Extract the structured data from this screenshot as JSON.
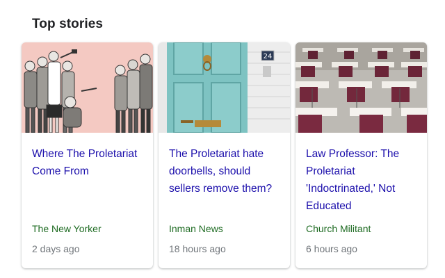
{
  "section": {
    "title": "Top stories"
  },
  "stories": [
    {
      "headline": "Where The Proletariat Come From",
      "source": "The New Yorker",
      "time": "2 days ago",
      "image": "cartoon-crowd-illustration"
    },
    {
      "headline": "The Proletariat hate doorbells, should sellers remove them?",
      "source": "Inman News",
      "time": "18 hours ago",
      "image": "teal-front-door-photo",
      "door_number": "24"
    },
    {
      "headline": "Law Professor: The Proletariat 'Indoctrinated,' Not Educated",
      "source": "Church Militant",
      "time": "6 hours ago",
      "image": "empty-classroom-desks-photo"
    }
  ],
  "colors": {
    "headline": "#1a0dab",
    "source": "#1e6b22",
    "time": "#70757a"
  }
}
